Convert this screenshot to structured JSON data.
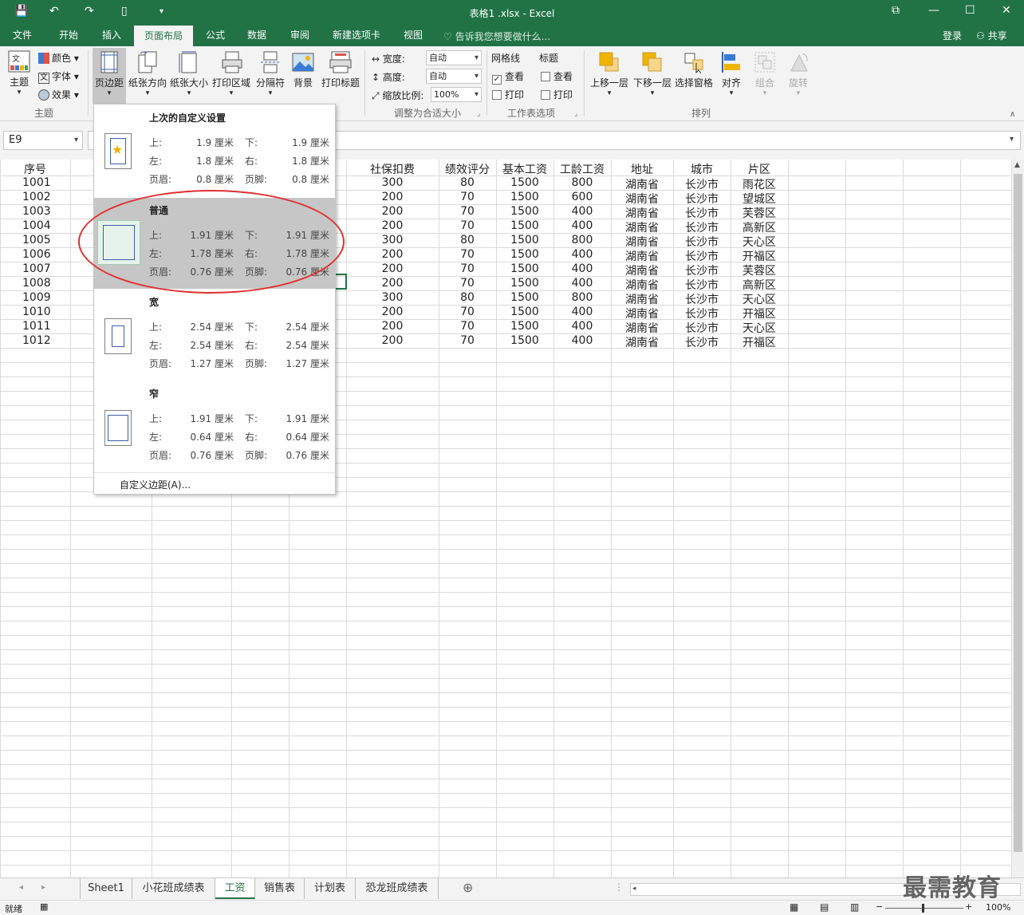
{
  "titlebar": {
    "title": "表格1 .xlsx - Excel"
  },
  "menu": {
    "tabs": [
      "文件",
      "开始",
      "插入",
      "页面布局",
      "公式",
      "数据",
      "审阅",
      "新建选项卡",
      "视图"
    ],
    "active": "页面布局",
    "tell_me": "告诉我您想要做什么...",
    "login": "登录",
    "share": "共享"
  },
  "ribbon": {
    "theme": {
      "main": "主题",
      "colors": "颜色",
      "fonts": "字体",
      "effects": "效果",
      "group": "主题"
    },
    "page_setup": {
      "margins": "页边距",
      "orientation": "纸张方向",
      "size": "纸张大小",
      "print_area": "打印区域",
      "breaks": "分隔符",
      "background": "背景",
      "print_titles": "打印标题"
    },
    "scale": {
      "width_label": "宽度:",
      "width_value": "自动",
      "height_label": "高度:",
      "height_value": "自动",
      "scale_label": "缩放比例:",
      "scale_value": "100%",
      "group": "调整为合适大小"
    },
    "sheet_options": {
      "gridlines": "网格线",
      "headings": "标题",
      "view": "查看",
      "print": "打印",
      "group": "工作表选项"
    },
    "arrange": {
      "forward": "上移一层",
      "backward": "下移一层",
      "selection_pane": "选择窗格",
      "align": "对齐",
      "group_btn": "组合",
      "rotate": "旋转",
      "group": "排列"
    }
  },
  "namebox": "E9",
  "sheet": {
    "headers_left": [
      "序号"
    ],
    "headers": [
      "社保扣费",
      "绩效评分",
      "基本工资",
      "工龄工资",
      "地址",
      "城市",
      "片区"
    ],
    "ids": [
      "1001",
      "1002",
      "1003",
      "1004",
      "1005",
      "1006",
      "1007",
      "1008",
      "1009",
      "1010",
      "1011",
      "1012"
    ],
    "rows": [
      [
        "300",
        "80",
        "1500",
        "800",
        "湖南省",
        "长沙市",
        "雨花区"
      ],
      [
        "200",
        "70",
        "1500",
        "600",
        "湖南省",
        "长沙市",
        "望城区"
      ],
      [
        "200",
        "70",
        "1500",
        "400",
        "湖南省",
        "长沙市",
        "芙蓉区"
      ],
      [
        "200",
        "70",
        "1500",
        "400",
        "湖南省",
        "长沙市",
        "高新区"
      ],
      [
        "300",
        "80",
        "1500",
        "800",
        "湖南省",
        "长沙市",
        "天心区"
      ],
      [
        "200",
        "70",
        "1500",
        "400",
        "湖南省",
        "长沙市",
        "开福区"
      ],
      [
        "200",
        "70",
        "1500",
        "400",
        "湖南省",
        "长沙市",
        "芙蓉区"
      ],
      [
        "200",
        "70",
        "1500",
        "400",
        "湖南省",
        "长沙市",
        "高新区"
      ],
      [
        "300",
        "80",
        "1500",
        "800",
        "湖南省",
        "长沙市",
        "天心区"
      ],
      [
        "200",
        "70",
        "1500",
        "400",
        "湖南省",
        "长沙市",
        "开福区"
      ],
      [
        "200",
        "70",
        "1500",
        "400",
        "湖南省",
        "长沙市",
        "天心区"
      ],
      [
        "200",
        "70",
        "1500",
        "400",
        "湖南省",
        "长沙市",
        "开福区"
      ]
    ]
  },
  "margins_menu": {
    "labels": {
      "top": "上:",
      "bottom": "下:",
      "left": "左:",
      "right": "右:",
      "header": "页眉:",
      "footer": "页脚:"
    },
    "options": [
      {
        "name": "上次的自定义设置",
        "top": "1.9 厘米",
        "bottom": "1.9 厘米",
        "left": "1.8 厘米",
        "right": "1.8 厘米",
        "header": "0.8 厘米",
        "footer": "0.8 厘米"
      },
      {
        "name": "普通",
        "top": "1.91 厘米",
        "bottom": "1.91 厘米",
        "left": "1.78 厘米",
        "right": "1.78 厘米",
        "header": "0.76 厘米",
        "footer": "0.76 厘米"
      },
      {
        "name": "宽",
        "top": "2.54 厘米",
        "bottom": "2.54 厘米",
        "left": "2.54 厘米",
        "right": "2.54 厘米",
        "header": "1.27 厘米",
        "footer": "1.27 厘米"
      },
      {
        "name": "窄",
        "top": "1.91 厘米",
        "bottom": "1.91 厘米",
        "left": "0.64 厘米",
        "right": "0.64 厘米",
        "header": "0.76 厘米",
        "footer": "0.76 厘米"
      }
    ],
    "custom": "自定义边距(A)..."
  },
  "sheet_tabs": [
    "Sheet1",
    "小花班成绩表",
    "工资",
    "销售表",
    "计划表",
    "恐龙班成绩表"
  ],
  "active_sheet": "工资",
  "status": {
    "ready": "就绪",
    "zoom": "100%"
  },
  "watermark": "最需教育"
}
